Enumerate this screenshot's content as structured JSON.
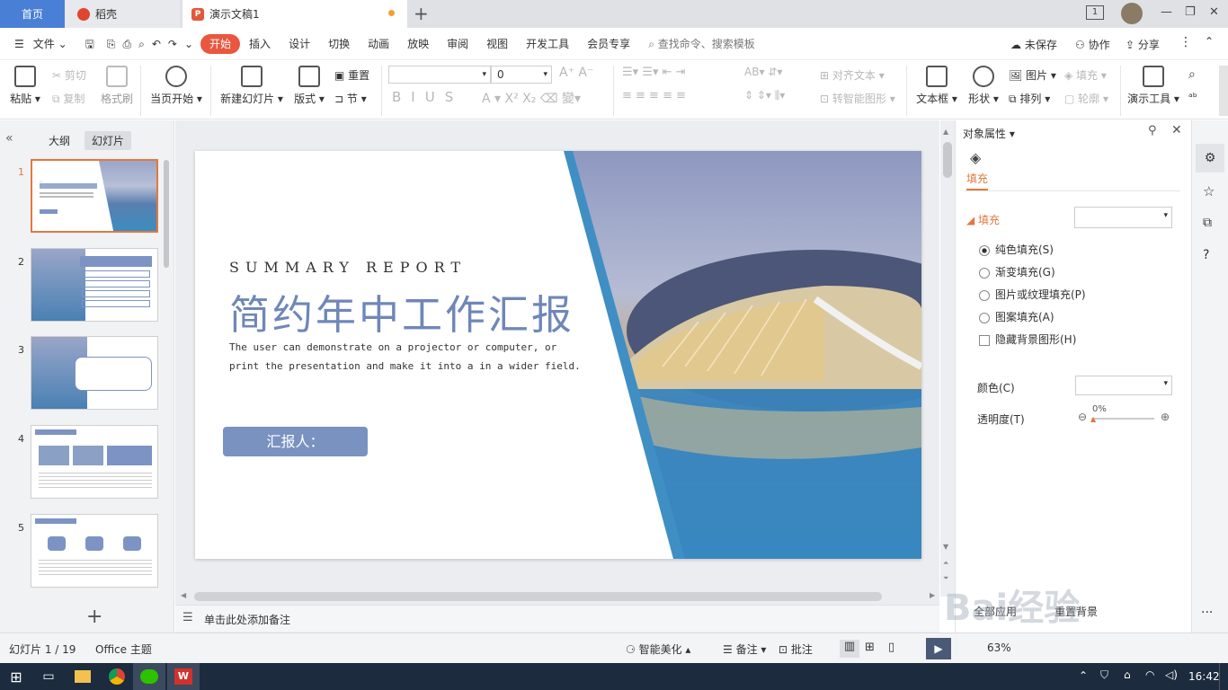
{
  "tabs": {
    "home": "首页",
    "daoke": "稻壳",
    "doc": "演示文稿1"
  },
  "menu": {
    "file": "文件",
    "items": [
      "开始",
      "插入",
      "设计",
      "切换",
      "动画",
      "放映",
      "审阅",
      "视图",
      "开发工具",
      "会员专享"
    ],
    "search": "查找命令、搜索模板",
    "unsaved": "未保存",
    "collab": "协作",
    "share": "分享"
  },
  "ribbon": {
    "paste": "粘贴",
    "cut": "剪切",
    "copy": "复制",
    "format_painter": "格式刷",
    "from_current": "当页开始",
    "new_slide": "新建幻灯片",
    "layout": "版式",
    "reset": "重置",
    "section": "节",
    "font_size": "0",
    "align_text": "对齐文本",
    "smart_art": "转智能图形",
    "textbox": "文本框",
    "shape": "形状",
    "picture": "图片",
    "arrange": "排列",
    "fill": "填充",
    "outline": "轮廓",
    "presentation_tools": "演示工具",
    "ab": "AB",
    "zoom_label": "A",
    "char_hint": "",
    "font_color": "A"
  },
  "left_panel": {
    "tab_outline": "大纲",
    "tab_slides": "幻灯片",
    "thumbnails": [
      "1",
      "2",
      "3",
      "4",
      "5"
    ]
  },
  "slide": {
    "subtitle": "SUMMARY REPORT",
    "title": "简约年中工作汇报",
    "desc_line1": "The user can demonstrate on a projector or computer, or",
    "desc_line2": "print the presentation and make it into a in a wider field.",
    "reporter": "汇报人：",
    "accent_color": "#6f87b8"
  },
  "notes": {
    "placeholder": "单击此处添加备注"
  },
  "right_panel": {
    "title": "对象属性",
    "tab_fill": "填充",
    "section_fill": "填充",
    "options": [
      "纯色填充(S)",
      "渐变填充(G)",
      "图片或纹理填充(P)",
      "图案填充(A)"
    ],
    "hide_bg": "隐藏背景图形(H)",
    "color_label": "颜色(C)",
    "transparency_label": "透明度(T)",
    "transparency_value": "0%",
    "apply_all": "全部应用",
    "reset_bg": "重置背景"
  },
  "status": {
    "slide_count": "幻灯片 1 / 19",
    "theme": "Office 主题",
    "smart_beautify": "智能美化",
    "notes": "备注",
    "comments": "批注",
    "zoom": "63%"
  },
  "taskbar": {
    "time": "16:42"
  },
  "watermark": "Bai经验"
}
